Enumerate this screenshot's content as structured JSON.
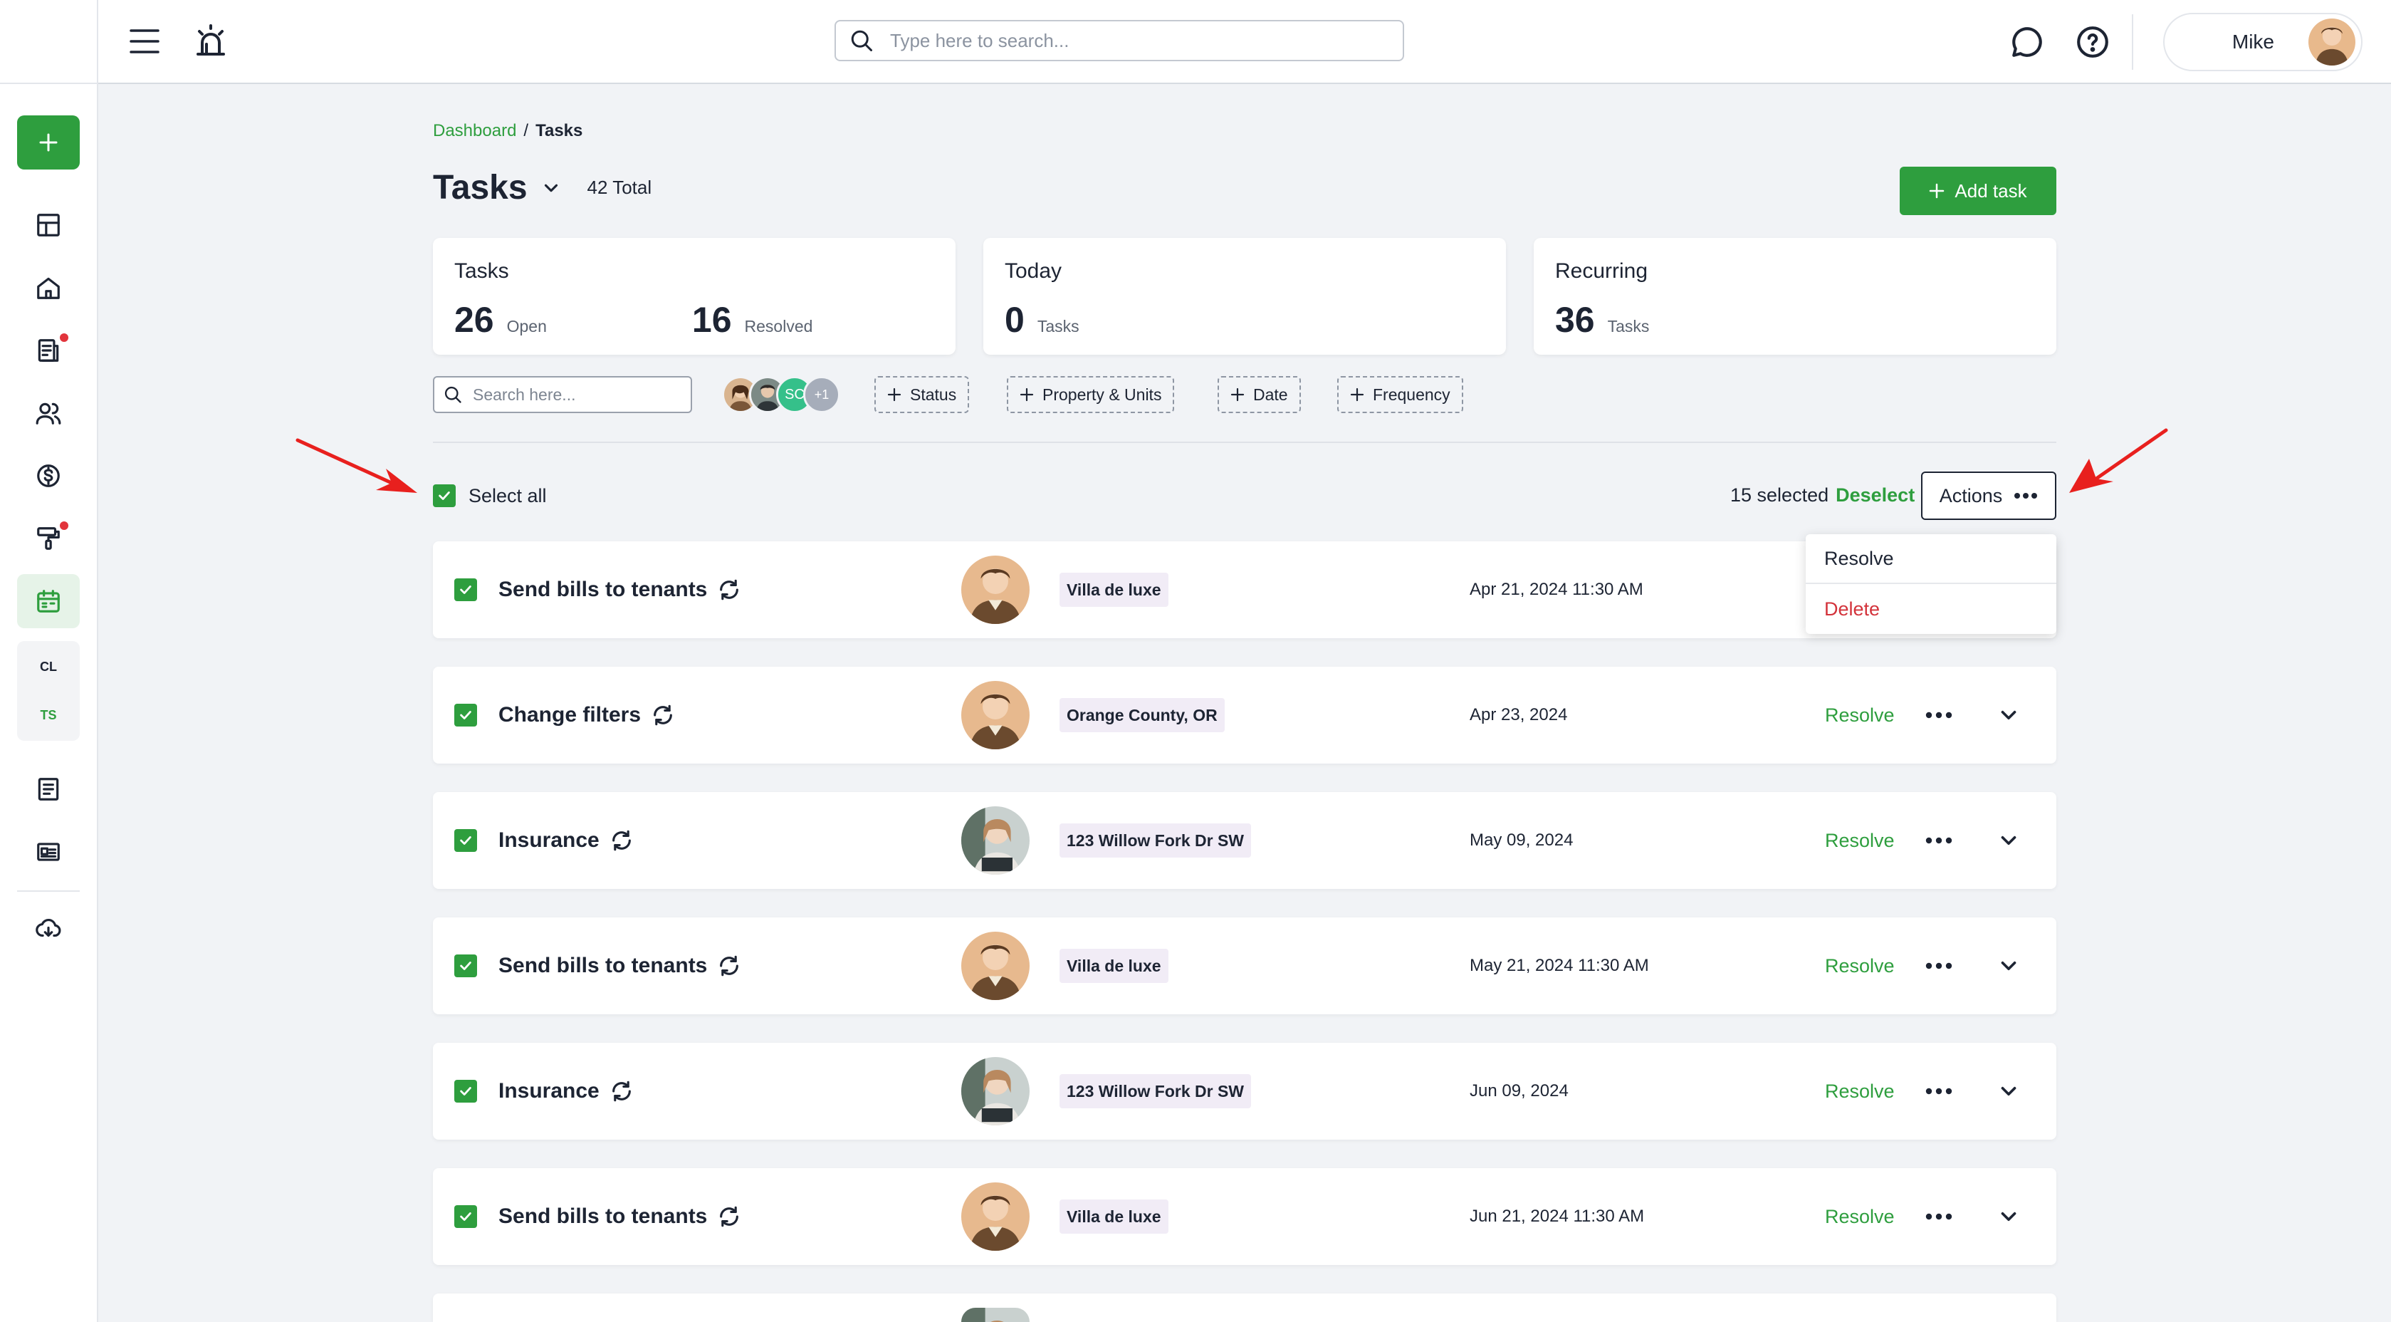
{
  "topbar": {
    "search_placeholder": "Type here to search...",
    "user_name": "Mike"
  },
  "sidebar": {
    "items": [
      {
        "icon": "dashboard-icon"
      },
      {
        "icon": "home-icon"
      },
      {
        "icon": "document-icon",
        "badge": true
      },
      {
        "icon": "people-icon"
      },
      {
        "icon": "dollar-icon"
      },
      {
        "icon": "paint-roller-icon",
        "badge": true
      },
      {
        "icon": "calendar-icon",
        "active": true
      }
    ],
    "sub_items": [
      "CL",
      "TS"
    ]
  },
  "breadcrumb": {
    "parent": "Dashboard",
    "separator": "/",
    "current": "Tasks"
  },
  "page": {
    "title": "Tasks",
    "total": "42 Total",
    "add_task": "Add task"
  },
  "cards": {
    "tasks": {
      "title": "Tasks",
      "open_num": "26",
      "open_lbl": "Open",
      "resolved_num": "16",
      "resolved_lbl": "Resolved"
    },
    "today": {
      "title": "Today",
      "num": "0",
      "lbl": "Tasks"
    },
    "recurring": {
      "title": "Recurring",
      "num": "36",
      "lbl": "Tasks"
    }
  },
  "filters": {
    "search_placeholder": "Search here...",
    "avatar_initials": "SC",
    "avatar_more": "+1",
    "chips": [
      "Status",
      "Property & Units",
      "Date",
      "Frequency"
    ]
  },
  "selection": {
    "select_all": "Select all",
    "count": "15 selected",
    "deselect": "Deselect",
    "actions": "Actions"
  },
  "actions_menu": {
    "resolve": "Resolve",
    "delete": "Delete"
  },
  "tasks": [
    {
      "name": "Send bills to tenants",
      "property": "Villa de luxe",
      "date": "Apr 21, 2024 11:30 AM",
      "resolve": "Resolve"
    },
    {
      "name": "Change filters",
      "property": "Orange County, OR",
      "date": "Apr 23, 2024",
      "resolve": "Resolve"
    },
    {
      "name": "Insurance",
      "property": "123 Willow Fork Dr SW",
      "date": "May 09, 2024",
      "resolve": "Resolve"
    },
    {
      "name": "Send bills to tenants",
      "property": "Villa de luxe",
      "date": "May 21, 2024 11:30 AM",
      "resolve": "Resolve"
    },
    {
      "name": "Insurance",
      "property": "123 Willow Fork Dr SW",
      "date": "Jun 09, 2024",
      "resolve": "Resolve"
    },
    {
      "name": "Send bills to tenants",
      "property": "Villa de luxe",
      "date": "Jun 21, 2024 11:30 AM",
      "resolve": "Resolve"
    }
  ],
  "colors": {
    "accent": "#2e9e3e",
    "danger": "#d3333b",
    "annotation": "#e8201e"
  }
}
